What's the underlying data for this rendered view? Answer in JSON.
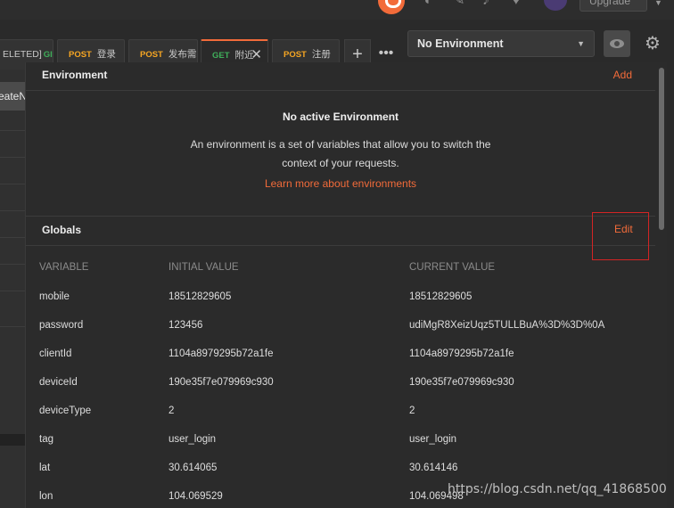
{
  "header": {
    "upgrade_label": "Upgrade"
  },
  "left_stub_text": "reateNa",
  "tabs": [
    {
      "method": "",
      "label": "ELETED]",
      "label2": "GI"
    },
    {
      "method": "POST",
      "label": "登录"
    },
    {
      "method": "POST",
      "label": "发布需求"
    },
    {
      "method": "GET",
      "label": "附近",
      "active": true
    },
    {
      "method": "POST",
      "label": "注册"
    }
  ],
  "environment_selector": {
    "selected": "No Environment"
  },
  "environment_section": {
    "title": "Environment",
    "add_label": "Add",
    "empty_title": "No active Environment",
    "empty_description": "An environment is a set of variables that allow you to switch the context of your requests.",
    "learn_more": "Learn more about environments"
  },
  "globals_section": {
    "title": "Globals",
    "edit_label": "Edit",
    "columns": [
      "VARIABLE",
      "INITIAL VALUE",
      "CURRENT VALUE"
    ],
    "rows": [
      [
        "mobile",
        "18512829605",
        "18512829605"
      ],
      [
        "password",
        "123456",
        "udiMgR8XeizUqz5TULLBuA%3D%3D%0A"
      ],
      [
        "clientId",
        "1104a8979295b72a1fe",
        "1104a8979295b72a1fe"
      ],
      [
        "deviceId",
        "190e35f7e079969c930",
        "190e35f7e079969c930"
      ],
      [
        "deviceType",
        "2",
        "2"
      ],
      [
        "tag",
        "user_login",
        "user_login"
      ],
      [
        "lat",
        "30.614065",
        "30.614146"
      ],
      [
        "lon",
        "104.069529",
        "104.069498"
      ]
    ]
  },
  "watermark": "https://blog.csdn.net/qq_41868500",
  "colors": {
    "accent": "#f26b3a",
    "post": "#f6a623",
    "get": "#3fae5a",
    "highlight_box": "#d32424"
  }
}
